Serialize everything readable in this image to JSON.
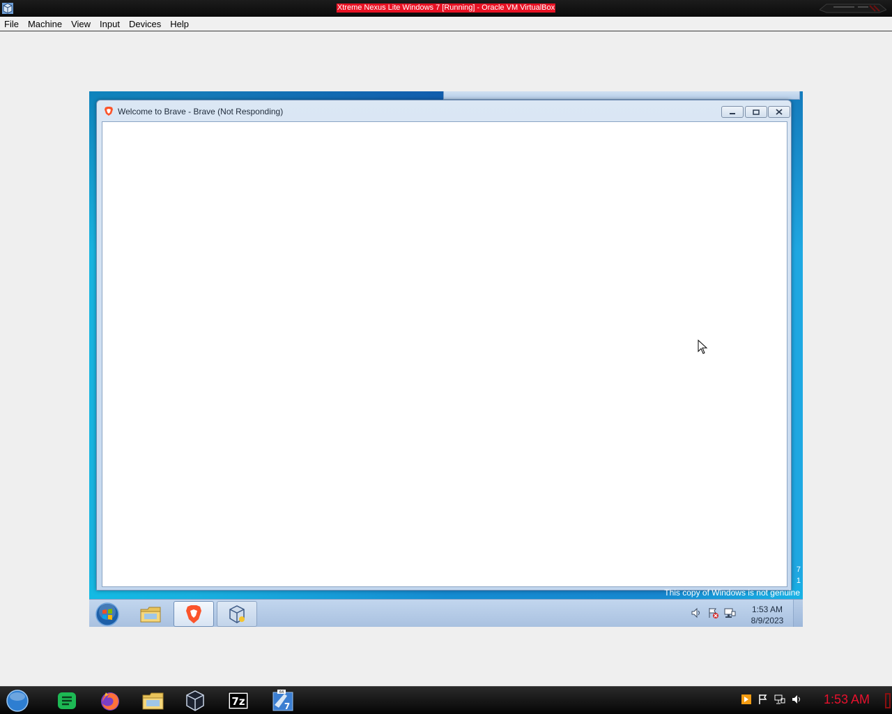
{
  "host": {
    "title": "Xtreme Nexus Lite Windows 7 [Running] - Oracle VM VirtualBox",
    "menu": [
      "File",
      "Machine",
      "View",
      "Input",
      "Devices",
      "Help"
    ],
    "clock": "1:53 AM",
    "taskbar_icons": [
      "start-orb-icon",
      "messaging-icon",
      "firefox-icon",
      "file-explorer-icon",
      "virtualbox-icon",
      "7zip-icon",
      "virtualbox-win7-icon"
    ]
  },
  "guest": {
    "brave_window": {
      "title": "Welcome to Brave - Brave (Not Responding)"
    },
    "genuine_notice": "This copy of Windows is not genuine",
    "side_digits": [
      "7",
      "1"
    ],
    "clock": {
      "time": "1:53 AM",
      "date": "8/9/2023"
    },
    "taskbar_icons": [
      "start-orb-icon",
      "file-explorer-icon",
      "brave-icon",
      "virtualbox-icon"
    ],
    "tray_icons": [
      "volume-icon",
      "action-center-icon",
      "network-icon"
    ]
  },
  "colors": {
    "host_title_highlight": "#e81123",
    "host_clock": "#e8112d",
    "vm_wallpaper": "#1a78c8"
  }
}
